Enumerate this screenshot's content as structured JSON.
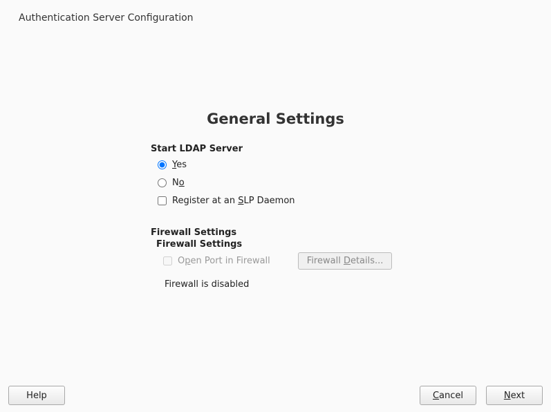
{
  "page_title": "Authentication Server Configuration",
  "heading": "General Settings",
  "ldap": {
    "section_label": "Start LDAP Server",
    "yes": {
      "pre": "",
      "m": "Y",
      "post": "es"
    },
    "no": {
      "pre": "N",
      "m": "o",
      "post": ""
    },
    "register": {
      "pre": "Register at an ",
      "m": "S",
      "post": "LP Daemon"
    }
  },
  "firewall": {
    "outer_label": "Firewall Settings",
    "inner_label": "Firewall Settings",
    "open_port": {
      "pre": "O",
      "m": "p",
      "post": "en Port in Firewall"
    },
    "details_btn": {
      "pre": "Firewall ",
      "m": "D",
      "post": "etails..."
    },
    "status": "Firewall is disabled"
  },
  "buttons": {
    "help": "Help",
    "cancel": {
      "pre": "",
      "m": "C",
      "post": "ancel"
    },
    "next": {
      "pre": "",
      "m": "N",
      "post": "ext"
    }
  }
}
